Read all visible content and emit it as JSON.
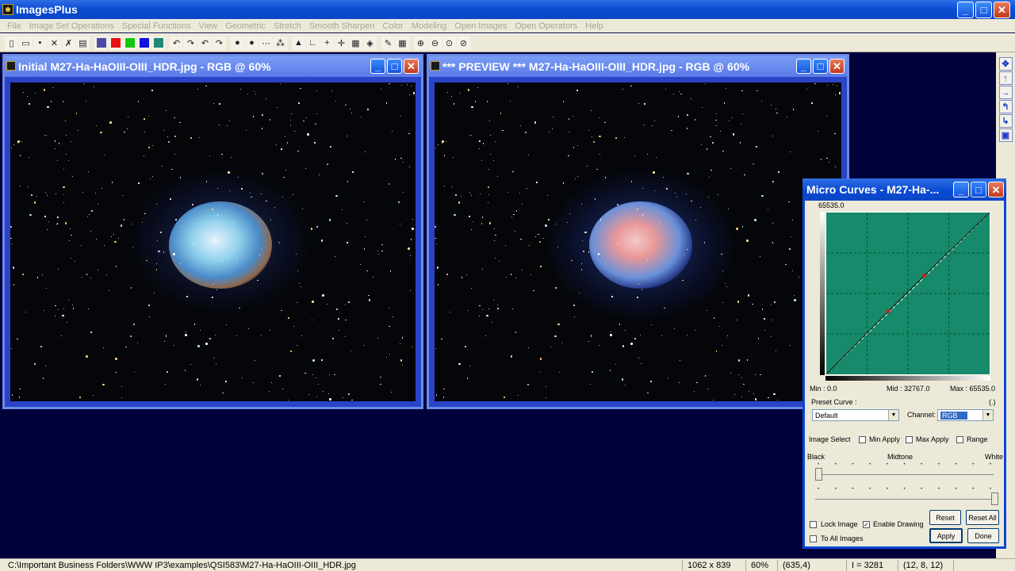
{
  "app": {
    "title": "ImagesPlus"
  },
  "menu": [
    "File",
    "Image Set Operations",
    "Special Functions",
    "View",
    "Geometric",
    "Stretch",
    "Smooth Sharpen",
    "Color",
    "Modeling",
    "Open Images",
    "Open Operators",
    "Help"
  ],
  "window_buttons": {
    "minimize": "_",
    "maximize": "□",
    "close": "✕"
  },
  "toolbar": [
    {
      "name": "new-icon",
      "glyph": "▯"
    },
    {
      "name": "open-icon",
      "glyph": "▭"
    },
    {
      "name": "save-icon",
      "glyph": "▪"
    },
    {
      "name": "close-icon",
      "glyph": "✕"
    },
    {
      "name": "close-all-icon",
      "glyph": "✗"
    },
    {
      "name": "print-icon",
      "glyph": "▤"
    },
    {
      "name": "rgb-channel-icon",
      "color": "#4a4aa8"
    },
    {
      "name": "red-channel-icon",
      "color": "#e81010"
    },
    {
      "name": "green-channel-icon",
      "color": "#10c810"
    },
    {
      "name": "blue-channel-icon",
      "color": "#1010e0"
    },
    {
      "name": "grid-icon",
      "color": "#208878"
    },
    {
      "name": "undo-icon",
      "glyph": "↶"
    },
    {
      "name": "redo-icon",
      "glyph": "↷"
    },
    {
      "name": "undo-all-icon",
      "glyph": "↶"
    },
    {
      "name": "redo-all-icon",
      "glyph": "↷"
    },
    {
      "name": "mask-icon",
      "glyph": "●"
    },
    {
      "name": "mask-invert-icon",
      "glyph": "●"
    },
    {
      "name": "dots-icon",
      "glyph": "⋯"
    },
    {
      "name": "star-select-icon",
      "glyph": "⁂"
    },
    {
      "name": "histogram-icon",
      "glyph": "▲"
    },
    {
      "name": "levels-icon",
      "glyph": "∟"
    },
    {
      "name": "add-icon",
      "glyph": "+"
    },
    {
      "name": "crosshair-icon",
      "glyph": "✛"
    },
    {
      "name": "calc-icon",
      "glyph": "▦"
    },
    {
      "name": "image-info-icon",
      "glyph": "◈"
    },
    {
      "name": "pencil-icon",
      "glyph": "✎"
    },
    {
      "name": "grid-select-icon",
      "glyph": "▦"
    },
    {
      "name": "zoom-in-icon",
      "glyph": "⊕"
    },
    {
      "name": "zoom-out-icon",
      "glyph": "⊖"
    },
    {
      "name": "zoom-fit-icon",
      "glyph": "⊙"
    },
    {
      "name": "zoom-actual-icon",
      "glyph": "⊘"
    }
  ],
  "right_tools": [
    {
      "name": "move-all-icon",
      "glyph": "✥"
    },
    {
      "name": "arrow-up-icon",
      "glyph": "↑"
    },
    {
      "name": "arrow-right-icon",
      "glyph": "→"
    },
    {
      "name": "arrow-return-icon",
      "glyph": "↰"
    },
    {
      "name": "arrow-down-return-icon",
      "glyph": "↳"
    },
    {
      "name": "copy-icon",
      "glyph": "▣"
    }
  ],
  "windows": {
    "initial": {
      "title": "Initial M27-Ha-HaOIII-OIII_HDR.jpg - RGB @ 60%"
    },
    "preview": {
      "title": "*** PREVIEW *** M27-Ha-HaOIII-OIII_HDR.jpg - RGB @ 60%"
    }
  },
  "curves": {
    "title": "Micro Curves - M27-Ha-...",
    "max_label": "65535.0",
    "min_text": "Min :  0.0",
    "mid_text": "Mid :  32767.0",
    "maxv_text": "Max :  65535.0",
    "preset_label": "Preset Curve :",
    "bracket": "(.)",
    "preset_value": "Default",
    "channel_label": "Channel:",
    "channel_value": "RGB",
    "image_select": "Image Select",
    "min_apply": "Min Apply",
    "max_apply": "Max Apply",
    "range": "Range",
    "black": "Black",
    "midtone": "Midtone",
    "white": "White",
    "lock_image": "Lock Image",
    "enable_drawing": "Enable Drawing",
    "to_all_images": "To All Images",
    "reset": "Reset",
    "reset_all": "Reset All",
    "apply": "Apply",
    "done": "Done",
    "lock_checked": false,
    "enable_drawing_checked": true,
    "to_all_checked": false,
    "min_apply_checked": false,
    "max_apply_checked": false,
    "range_checked": false,
    "curve_points": [
      [
        0.0,
        0.0
      ],
      [
        0.38,
        0.39
      ],
      [
        0.6,
        0.61
      ],
      [
        1.0,
        1.0
      ]
    ],
    "graph_color": "#168a6a",
    "point_color": "#e01818"
  },
  "status": {
    "path": "C:\\Important Business Folders\\WWW IP3\\examples\\QSI583\\M27-Ha-HaOIII-OIII_HDR.jpg",
    "size": "1062 x 839",
    "zoom": "60%",
    "coords": "(635,4)",
    "intensity": "I = 3281",
    "rgb": "(12, 8, 12)"
  }
}
